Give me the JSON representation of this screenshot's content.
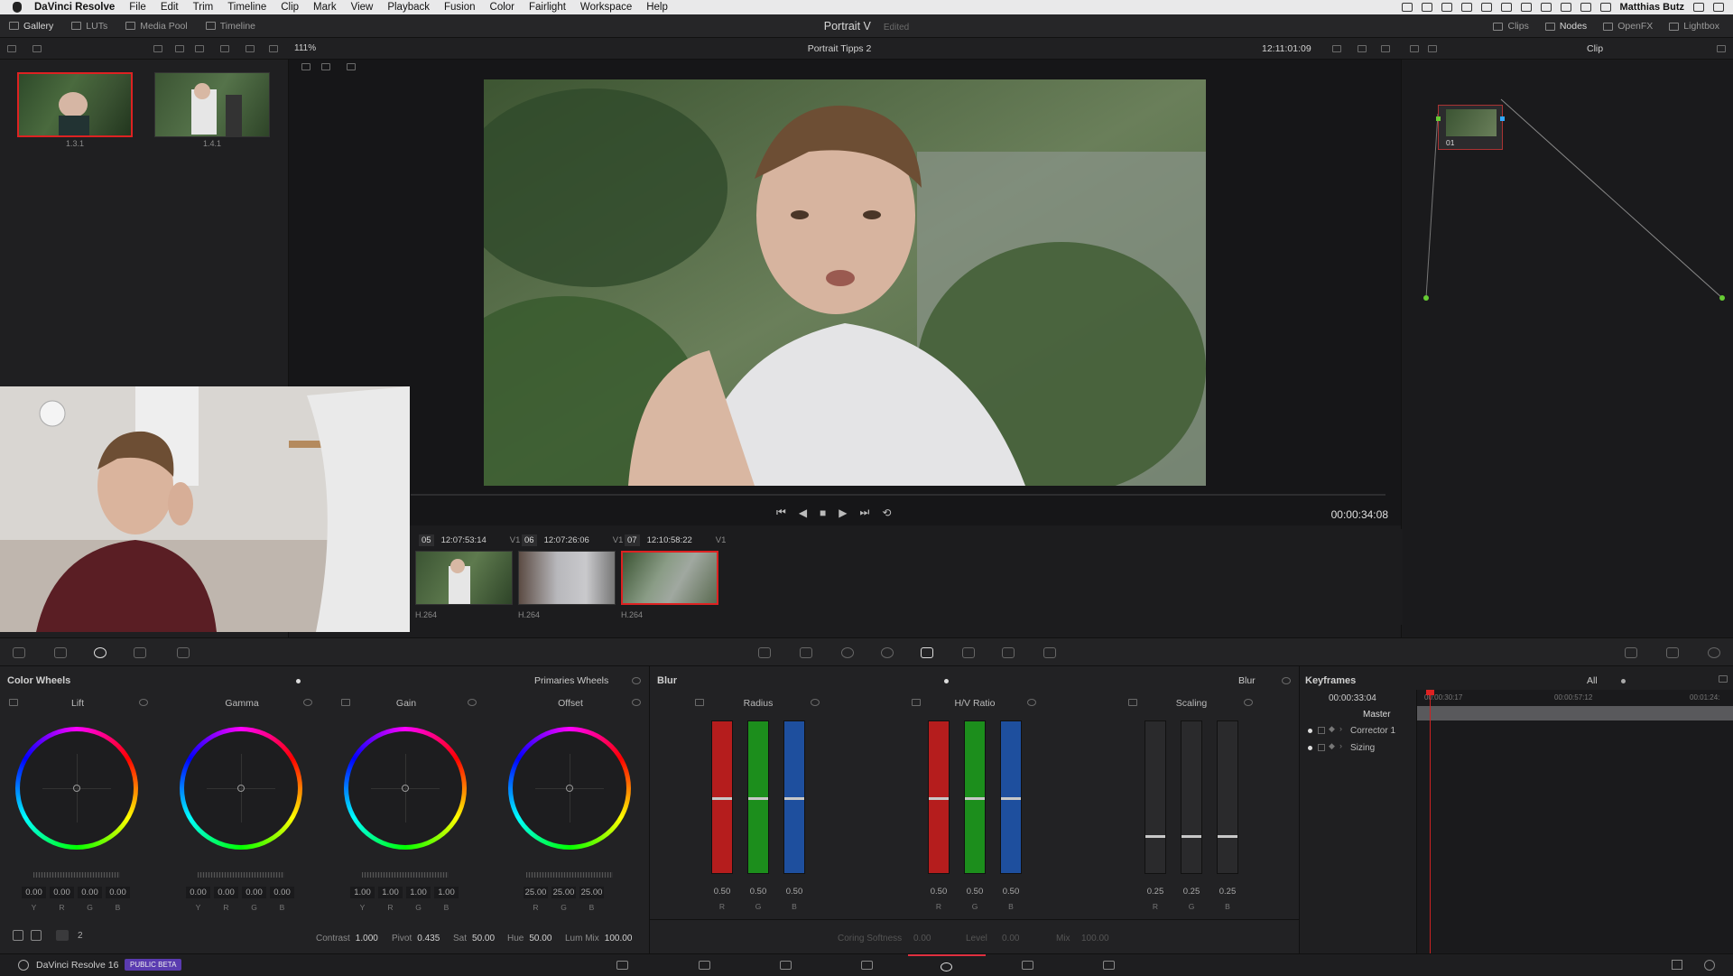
{
  "menubar": {
    "app": "DaVinci Resolve",
    "items": [
      "File",
      "Edit",
      "Trim",
      "Timeline",
      "Clip",
      "Mark",
      "View",
      "Playback",
      "Fusion",
      "Color",
      "Fairlight",
      "Workspace",
      "Help"
    ],
    "user": "Matthias Butz"
  },
  "toolbar": {
    "left": [
      "Gallery",
      "LUTs",
      "Media Pool",
      "Timeline"
    ],
    "project_title": "Portrait V",
    "edited": "Edited",
    "right": [
      "Clips",
      "Nodes",
      "OpenFX",
      "Lightbox"
    ]
  },
  "secondbar": {
    "zoom": "111%",
    "timeline_name": "Portrait Tipps 2",
    "timecode": "12:11:01:09",
    "node_mode": "Clip"
  },
  "gallery": {
    "stills": [
      {
        "label": "1.3.1",
        "selected": true
      },
      {
        "label": "1.4.1",
        "selected": false
      }
    ]
  },
  "viewer": {
    "timecode": "00:00:34:08"
  },
  "nodes": [
    {
      "label": "01"
    }
  ],
  "clips": [
    {
      "num": "05",
      "tc": "12:07:53:14",
      "track": "V1",
      "codec": "H.264"
    },
    {
      "num": "06",
      "tc": "12:07:26:06",
      "track": "V1",
      "codec": "H.264"
    },
    {
      "num": "07",
      "tc": "12:10:58:22",
      "track": "V1",
      "codec": "H.264"
    }
  ],
  "colorwheels": {
    "title": "Color Wheels",
    "mode": "Primaries Wheels",
    "wheels": [
      {
        "name": "Lift",
        "values": [
          "0.00",
          "0.00",
          "0.00",
          "0.00"
        ],
        "channels": [
          "Y",
          "R",
          "G",
          "B"
        ]
      },
      {
        "name": "Gamma",
        "values": [
          "0.00",
          "0.00",
          "0.00",
          "0.00"
        ],
        "channels": [
          "Y",
          "R",
          "G",
          "B"
        ]
      },
      {
        "name": "Gain",
        "values": [
          "1.00",
          "1.00",
          "1.00",
          "1.00"
        ],
        "channels": [
          "Y",
          "R",
          "G",
          "B"
        ]
      },
      {
        "name": "Offset",
        "values": [
          "25.00",
          "25.00",
          "25.00"
        ],
        "channels": [
          "R",
          "G",
          "B"
        ]
      }
    ],
    "footer": {
      "page": "2",
      "contrast_label": "Contrast",
      "contrast": "1.000",
      "pivot_label": "Pivot",
      "pivot": "0.435",
      "sat_label": "Sat",
      "sat": "50.00",
      "hue_label": "Hue",
      "hue": "50.00",
      "lummix_label": "Lum Mix",
      "lummix": "100.00"
    }
  },
  "blur": {
    "title": "Blur",
    "mode": "Blur",
    "groups": [
      {
        "name": "Radius",
        "values": [
          "0.50",
          "0.50",
          "0.50"
        ],
        "channels": [
          "R",
          "G",
          "B"
        ],
        "level": 0.5
      },
      {
        "name": "H/V Ratio",
        "values": [
          "0.50",
          "0.50",
          "0.50"
        ],
        "channels": [
          "R",
          "G",
          "B"
        ],
        "level": 0.5
      },
      {
        "name": "Scaling",
        "values": [
          "0.25",
          "0.25",
          "0.25"
        ],
        "channels": [
          "R",
          "G",
          "B"
        ],
        "level": 0.25
      }
    ],
    "footer": {
      "coring_label": "Coring Softness",
      "coring": "0.00",
      "level_label": "Level",
      "level": "0.00",
      "mix_label": "Mix",
      "mix": "100.00"
    }
  },
  "keyframes": {
    "title": "Keyframes",
    "filter": "All",
    "current": "00:00:33:04",
    "ticks": [
      "00:00:30:17",
      "00:00:57:12",
      "00:01:24:"
    ],
    "rows": [
      "Master",
      "Corrector 1",
      "Sizing"
    ]
  },
  "bottom": {
    "app": "DaVinci Resolve 16",
    "badge": "PUBLIC BETA"
  }
}
